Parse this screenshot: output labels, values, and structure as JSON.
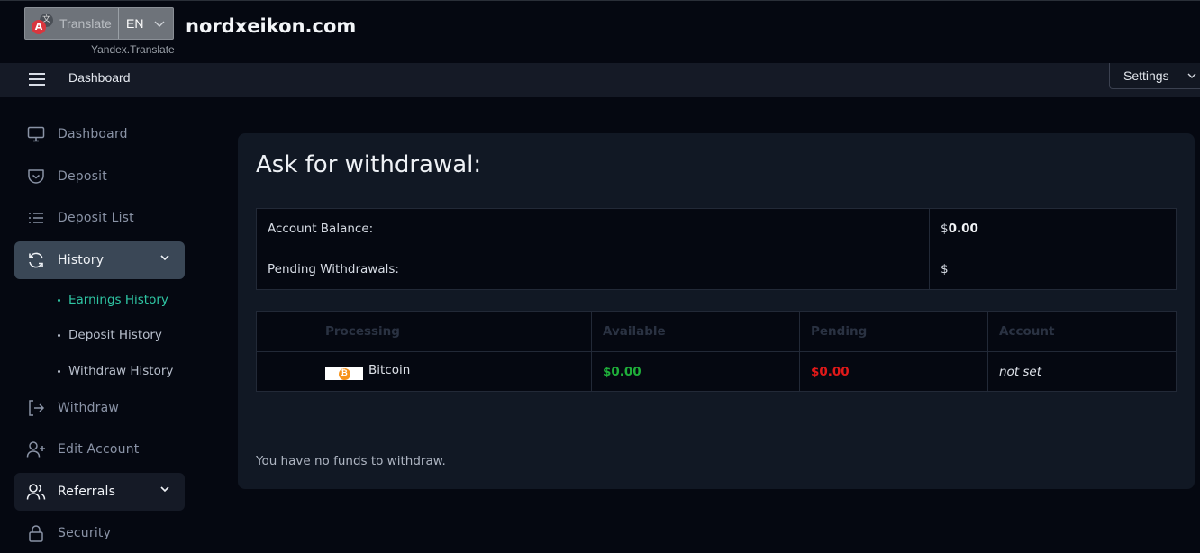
{
  "translate_widget": {
    "button_label": "Translate",
    "language": "EN",
    "provider": "Yandex.Translate"
  },
  "site": {
    "name": "nordxeikon.com"
  },
  "header": {
    "title": "Dashboard",
    "settings_label": "Settings"
  },
  "sidebar": {
    "items": [
      {
        "label": "Dashboard",
        "icon": "monitor-icon"
      },
      {
        "label": "Deposit",
        "icon": "wallet-icon"
      },
      {
        "label": "Deposit List",
        "icon": "list-icon"
      },
      {
        "label": "History",
        "icon": "refresh-icon",
        "expanded": true
      },
      {
        "label": "Withdraw",
        "icon": "logout-icon"
      },
      {
        "label": "Edit Account",
        "icon": "user-plus-icon"
      },
      {
        "label": "Referrals",
        "icon": "users-icon"
      },
      {
        "label": "Security",
        "icon": "lock-icon"
      }
    ],
    "history_sub": [
      {
        "label": "Earnings History",
        "current": true
      },
      {
        "label": "Deposit History"
      },
      {
        "label": "Withdraw History"
      }
    ]
  },
  "main": {
    "title": "Ask for withdrawal:",
    "balance_rows": [
      {
        "label": "Account Balance:",
        "currency": "$",
        "value": "0.00"
      },
      {
        "label": "Pending Withdrawals:",
        "currency": "$",
        "value": ""
      }
    ],
    "processing_table": {
      "headers": [
        "",
        "Processing",
        "Available",
        "Pending",
        "Account"
      ],
      "rows": [
        {
          "processor": "Bitcoin",
          "available": "$0.00",
          "pending": "$0.00",
          "account": "not set"
        }
      ]
    },
    "message": "You have no funds to withdraw."
  },
  "colors": {
    "accent": "#2fc6a4",
    "available": "#1fae3a",
    "pending": "#e01919",
    "bitcoin": "#f7931a"
  }
}
